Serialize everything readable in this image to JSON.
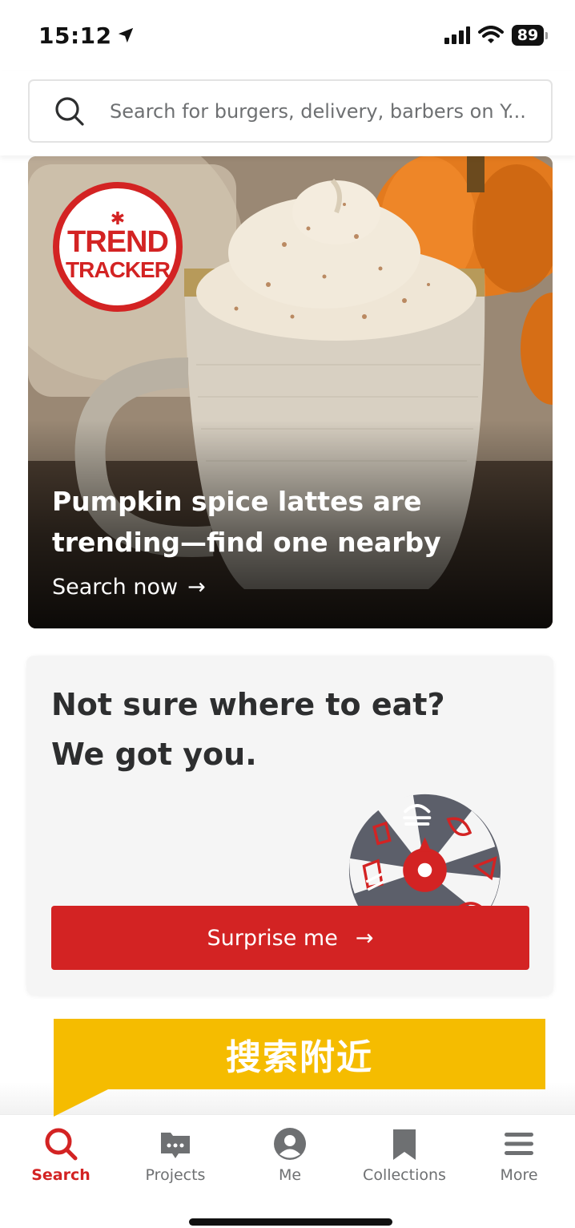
{
  "status_bar": {
    "time": "15:12",
    "battery": "89",
    "icons": [
      "location-arrow-icon",
      "cellular-signal-icon",
      "wifi-icon",
      "battery-icon"
    ]
  },
  "search": {
    "placeholder": "Search for burgers, delivery, barbers on Y...",
    "icon": "search-icon"
  },
  "hero": {
    "badge_line1": "TREND",
    "badge_line2": "TRACKER",
    "title": "Pumpkin spice lattes are trending—find one nearby",
    "cta": "Search now",
    "cta_arrow": "→"
  },
  "surprise": {
    "heading": "Not sure where to eat? We got you.",
    "button_label": "Surprise me",
    "button_arrow": "→",
    "wheel_icons": [
      "burger-icon",
      "salad-icon",
      "pizza-icon",
      "drink-icon",
      "sandwich-icon",
      "taco-icon",
      "noodles-icon"
    ]
  },
  "overlay": {
    "banner_text": "搜索附近"
  },
  "tabs": [
    {
      "label": "Search",
      "icon": "search-icon",
      "active": true
    },
    {
      "label": "Projects",
      "icon": "projects-icon",
      "active": false
    },
    {
      "label": "Me",
      "icon": "me-icon",
      "active": false
    },
    {
      "label": "Collections",
      "icon": "bookmark-icon",
      "active": false
    },
    {
      "label": "More",
      "icon": "menu-icon",
      "active": false
    }
  ],
  "colors": {
    "brand_red": "#d32323",
    "banner_yellow": "#f5bc00",
    "text_dark": "#2d2e2f",
    "tab_gray": "#6e7072",
    "wheel_gray": "#5c5f6a"
  }
}
